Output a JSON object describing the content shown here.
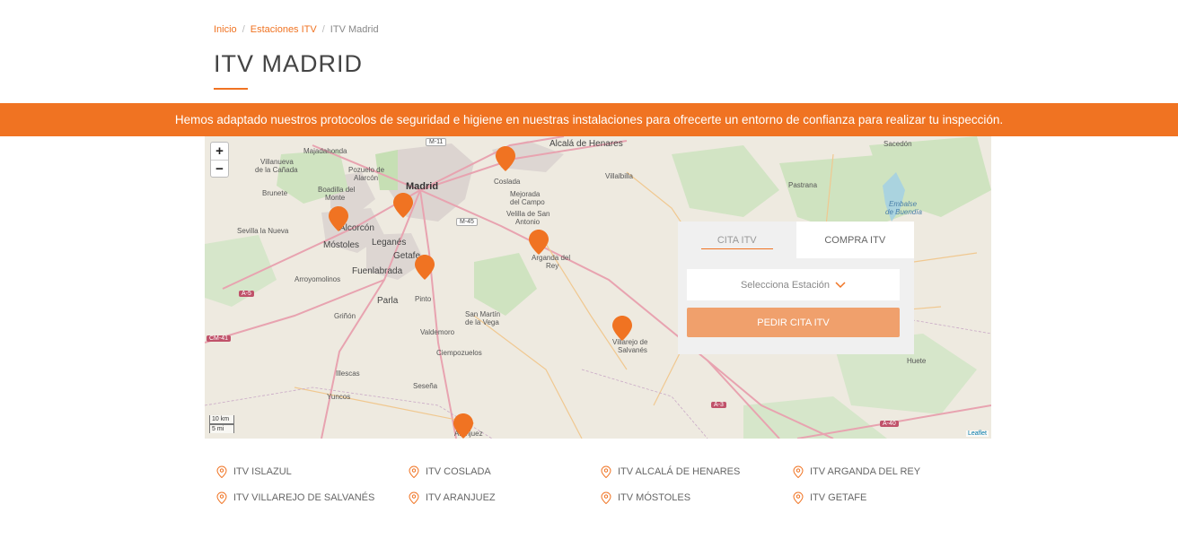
{
  "breadcrumb": {
    "home": "Inicio",
    "stations": "Estaciones ITV",
    "current": "ITV Madrid",
    "separator": "/"
  },
  "page": {
    "title": "ITV MADRID"
  },
  "banner": {
    "text": "Hemos adaptado nuestros protocolos de seguridad e higiene en nuestras instalaciones para ofrecerte un entorno de confianza para realizar tu inspección."
  },
  "map": {
    "zoom_in": "+",
    "zoom_out": "−",
    "scale_km": "10 km",
    "scale_mi": "5 mi",
    "attribution": "Leaflet",
    "places": {
      "alcala": "Alcalá de Henares",
      "madrid": "Madrid",
      "majadahonda": "Majadahonda",
      "villanueva": "Villanueva",
      "dela_canada": "de la Cañada",
      "pozuelo": "Pozuelo de",
      "alarcon": "Alarcón",
      "boadilla": "Boadilla del",
      "monte": "Monte",
      "brunete": "Brunete",
      "coslada": "Coslada",
      "mejorada": "Mejorada",
      "del_campo": "del Campo",
      "velilla": "Velilla de San",
      "antonio": "Antonio",
      "villalbilla": "Villalbilla",
      "alcorcon": "Alcorcón",
      "mostoles": "Móstoles",
      "leganes": "Leganés",
      "getafe": "Getafe",
      "sevilla": "Sevilla la Nueva",
      "fuenlabrada": "Fuenlabrada",
      "arroyomolinos": "Arroyomolinos",
      "parla": "Parla",
      "pinto": "Pinto",
      "arganda": "Arganda del",
      "rey": "Rey",
      "san_martin": "San Martín",
      "de_la_vega": "de la Vega",
      "grinon": "Griñón",
      "valdemoro": "Valdemoro",
      "ciempozuelos": "Ciempozuelos",
      "illescas": "Illescas",
      "sesena": "Seseña",
      "yuncos": "Yuncos",
      "aranjuez": "Aranjuez",
      "villarejo": "Villarejo de",
      "salvanes": "Salvanés",
      "pastrana": "Pastrana",
      "sacedon": "Sacedón",
      "embalse": "Embalse",
      "de_buendia": "de Buendía",
      "huete": "Huete"
    },
    "roads": {
      "m11": "M-11",
      "m45": "M-45",
      "a5": "A-5",
      "cm41": "CM-41",
      "a3": "A-3",
      "a40": "A-40"
    }
  },
  "booking": {
    "tab_cita": "CITA ITV",
    "tab_compra": "COMPRA ITV",
    "select_placeholder": "Selecciona Estación",
    "submit": "PEDIR CITA ITV"
  },
  "stations": [
    "ITV ISLAZUL",
    "ITV COSLADA",
    "ITV ALCALÁ DE HENARES",
    "ITV ARGANDA DEL REY",
    "ITV VILLAREJO DE SALVANÉS",
    "ITV ARANJUEZ",
    "ITV MÓSTOLES",
    "ITV GETAFE"
  ],
  "colors": {
    "accent": "#f07322",
    "button": "#f0a06c",
    "marker": "#f07322"
  }
}
